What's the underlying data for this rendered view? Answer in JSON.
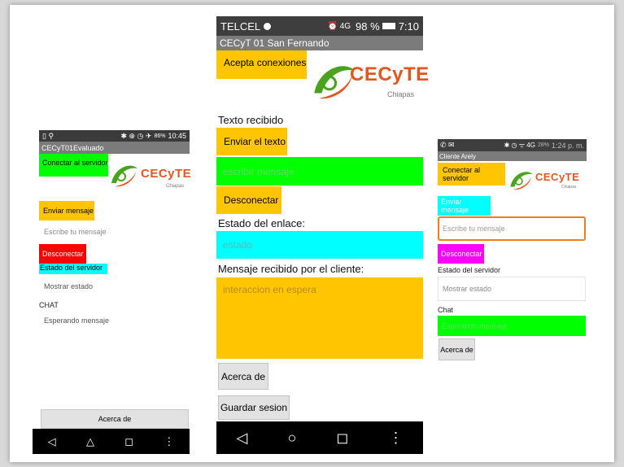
{
  "left_phone": {
    "status": {
      "icons_left": "▯ ⚲",
      "icons_right": "✱ ⊕ ◷ ✈",
      "battery": "86%",
      "time": "10:45"
    },
    "title": "CECyT01Evaluado",
    "connect_btn": "Conectar al servidor",
    "logo": {
      "name": "CECyTE",
      "sub": "Chiapas"
    },
    "send_btn": "Enviar mensaje",
    "message_placeholder": "Escribe tu mensaje",
    "disconnect_btn": "Desconectar",
    "server_status_label": "Estado del servidor",
    "show_status": "Mostrar estado",
    "chat_label": "CHAT",
    "waiting_message": "Esperando mensaje",
    "about_btn": "Acerca de",
    "nav": [
      "◁",
      "△",
      "◻",
      "⋮"
    ]
  },
  "center_phone": {
    "status": {
      "carrier": "TELCEL",
      "icons_right": "⏰ 4G",
      "battery": "98 %",
      "time": "7:10"
    },
    "title": "CECyT 01 San Fernando",
    "accept_btn": "Acepta conexiones",
    "logo": {
      "name": "CECyTE",
      "sub": "Chiapas"
    },
    "received_text_label": "Texto recibido",
    "send_text_btn": "Enviar el texto",
    "write_placeholder": "escribir mensaje",
    "disconnect_btn": "Desconectar",
    "link_status_label": "Estado del enlace:",
    "status_field": "estado",
    "client_message_label": "Mensaje recibido por el cliente:",
    "waiting_interaction": "interaccion en espera",
    "about_btn": "Acerca de",
    "save_btn": "Guardar sesion",
    "nav": [
      "◁",
      "○",
      "◻",
      "⋮"
    ]
  },
  "right_phone": {
    "status": {
      "icons_left": "✆ ✉",
      "icons_right": "✱ ◷ ᯤ 4G",
      "battery": "28%",
      "time": "1:24 p. m."
    },
    "title": "Cliente Arely",
    "connect_btn": "Conectar al servidor",
    "logo": {
      "name": "CECyTE",
      "sub": "Chiapas"
    },
    "send_btn": "Enviar mensaje",
    "message_placeholder": "Escribe tu mensaje",
    "disconnect_btn": "Desconectar",
    "server_status_label": "Estado del servidor",
    "show_status": "Mostrar estado",
    "chat_label": "Chat",
    "waiting_message": "Esperando mensaje",
    "about_btn": "Acerca de"
  },
  "colors": {
    "yellow": "#ffc600",
    "green": "#00ff00",
    "red": "#ff0000",
    "cyan": "#00ffff",
    "magenta": "#ff00ff",
    "gray_bar": "#7b7b7b",
    "dark_status": "#3e3e3e"
  }
}
